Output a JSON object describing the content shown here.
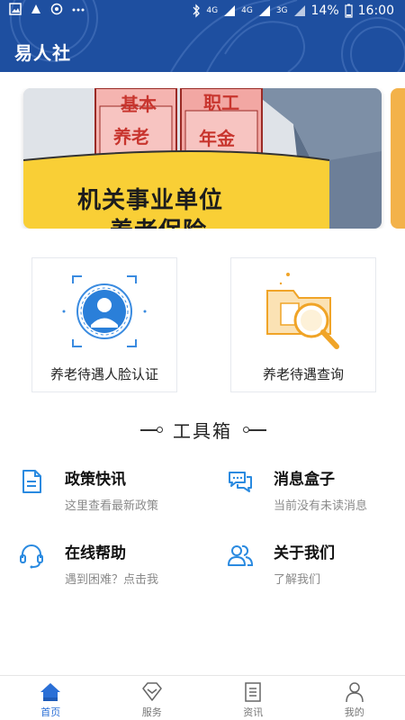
{
  "status_bar": {
    "left_icons": [
      "image-icon",
      "app-icon",
      "sync-icon",
      "more-dots-icon"
    ],
    "network_label": "4G",
    "network_label2": "4G",
    "network_label3": "3G",
    "battery": "14%",
    "time": "16:00"
  },
  "app_bar": {
    "title": "易人社"
  },
  "banner": {
    "box_label_1": "基本",
    "box_label_2": "养老",
    "box_label_3": "职工",
    "box_label_4": "年金",
    "line1": "机关事业单位",
    "line2": "养老保险"
  },
  "cards": [
    {
      "label": "养老待遇人脸认证",
      "icon": "face-recognition-icon"
    },
    {
      "label": "养老待遇查询",
      "icon": "folder-search-icon"
    }
  ],
  "toolbox": {
    "title": "工具箱",
    "items": [
      {
        "title": "政策快讯",
        "subtitle": "这里查看最新政策",
        "icon": "document-icon"
      },
      {
        "title": "消息盒子",
        "subtitle": "当前没有未读消息",
        "icon": "chat-bubbles-icon"
      },
      {
        "title": "在线帮助",
        "subtitle": "遇到困难？点击我",
        "icon": "headset-icon"
      },
      {
        "title": "关于我们",
        "subtitle": "了解我们",
        "icon": "users-icon"
      }
    ]
  },
  "bottom_nav": {
    "items": [
      {
        "label": "首页",
        "icon": "home-icon",
        "active": true
      },
      {
        "label": "服务",
        "icon": "diamond-icon",
        "active": false
      },
      {
        "label": "资讯",
        "icon": "news-icon",
        "active": false
      },
      {
        "label": "我的",
        "icon": "person-icon",
        "active": false
      }
    ]
  },
  "colors": {
    "primary": "#1e4fa0",
    "accent_blue": "#2a8ae0",
    "accent_orange": "#f0a427",
    "active_tab": "#2a6fd6"
  }
}
